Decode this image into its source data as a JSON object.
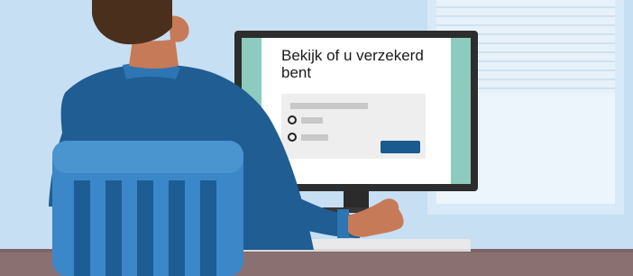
{
  "screen": {
    "title": "Bekijk of u verzekerd bent"
  },
  "colors": {
    "wall": "#c7dff3",
    "window_frame": "#d8e9f7",
    "blind": "#e8f1fa",
    "monitor_bezel": "#2d2d2d",
    "screen_accent": "#8ccbbd",
    "form_panel": "#eeeeee",
    "placeholder_bar": "#c8c8c8",
    "button": "#195a8f",
    "sweater": "#1f5d93",
    "chair": "#3b87c7",
    "skin": "#c77a57",
    "hair": "#4a2f1d",
    "desk": "#8b7072"
  },
  "icons": {
    "radio_1": "radio-button-empty-icon",
    "radio_2": "radio-button-empty-icon"
  }
}
